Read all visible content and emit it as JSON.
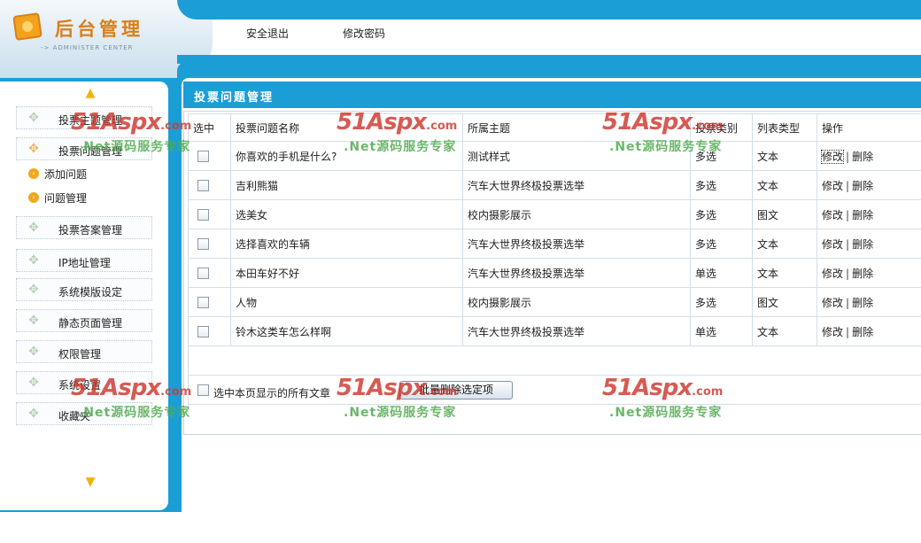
{
  "header": {
    "title": "后台管理",
    "subtitle": "-> ADMINISTER CENTER",
    "nav": {
      "logout": "安全退出",
      "change_password": "修改密码"
    }
  },
  "sidebar": {
    "items": [
      {
        "label": "投票主题管理"
      },
      {
        "label": "投票问题管理"
      },
      {
        "label": "投票答案管理"
      },
      {
        "label": "IP地址管理"
      },
      {
        "label": "系统模版设定"
      },
      {
        "label": "静态页面管理"
      },
      {
        "label": "权限管理"
      },
      {
        "label": "系统设置"
      },
      {
        "label": "收藏夹"
      }
    ],
    "subitems": [
      {
        "label": "添加问题"
      },
      {
        "label": "问题管理"
      }
    ]
  },
  "panel": {
    "title": "投票问题管理",
    "columns": [
      "选中",
      "投票问题名称",
      "所属主题",
      "投票类别",
      "列表类型",
      "操作"
    ],
    "rows": [
      {
        "name": "你喜欢的手机是什么?",
        "theme": "测试样式",
        "category": "多选",
        "list_type": "文本",
        "edit": "修改",
        "delete": "删除"
      },
      {
        "name": "吉利熊猫",
        "theme": "汽车大世界终极投票选举",
        "category": "多选",
        "list_type": "文本",
        "edit": "修改",
        "delete": "删除"
      },
      {
        "name": "选美女",
        "theme": "校内摄影展示",
        "category": "多选",
        "list_type": "图文",
        "edit": "修改",
        "delete": "删除"
      },
      {
        "name": "选择喜欢的车辆",
        "theme": "汽车大世界终极投票选举",
        "category": "多选",
        "list_type": "文本",
        "edit": "修改",
        "delete": "删除"
      },
      {
        "name": "本田车好不好",
        "theme": "汽车大世界终极投票选举",
        "category": "单选",
        "list_type": "文本",
        "edit": "修改",
        "delete": "删除"
      },
      {
        "name": "人物",
        "theme": "校内摄影展示",
        "category": "多选",
        "list_type": "图文",
        "edit": "修改",
        "delete": "删除"
      },
      {
        "name": "铃木这类车怎么样啊",
        "theme": "汽车大世界终极投票选举",
        "category": "单选",
        "list_type": "文本",
        "edit": "修改",
        "delete": "删除"
      }
    ],
    "separator": "|",
    "select_all_label": "选中本页显示的所有文章",
    "batch_delete_label": "批量删除选定项"
  },
  "watermark": {
    "logo": "51Aspx",
    "logo_suffix": ".com",
    "tagline": ".Net源码服务专家"
  },
  "colors": {
    "accent": "#1b9ed6",
    "brand_orange": "#d9801a",
    "watermark_red": "#cd372d",
    "watermark_green": "#50aa50"
  }
}
